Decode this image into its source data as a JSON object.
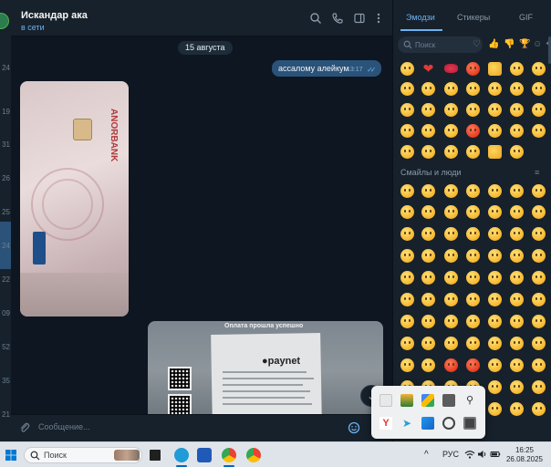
{
  "left_strip": {
    "numbers": [
      "24",
      "19",
      "31",
      "26",
      "25",
      "24",
      "22",
      "09",
      "52",
      "35",
      "21"
    ]
  },
  "chat": {
    "name": "Искандар ака",
    "status": "в сети",
    "date_divider": "15 августа",
    "outgoing_message": {
      "text": "ассалому алейкум",
      "time": "13:17",
      "ticks": "✓✓"
    },
    "card_photo": {
      "brand": "ANORBANK"
    },
    "receipt_photo": {
      "title": "Оплата прошла успешно",
      "logo": "●paynet"
    },
    "scroll_down_glyph": "⌄"
  },
  "input": {
    "placeholder": "Сообщение..."
  },
  "emoji_panel": {
    "tabs": [
      "Эмодзи",
      "Стикеры",
      "GIF"
    ],
    "active_tab": "Эмодзи",
    "search_placeholder": "Поиск",
    "category_icons": [
      "heart-outline",
      "thumbs-up-outline",
      "thumbs-down-outline",
      "trophy-outline",
      "party-outline",
      "sparkles-outline"
    ],
    "category_glyphs": [
      "♡",
      "👍",
      "👎",
      "🏆",
      "☺",
      "✦"
    ],
    "section_title": "Смайлы и люди",
    "section_icon": "≡"
  },
  "taskbar": {
    "search_placeholder": "Поиск",
    "chevron": "^",
    "language": "РУС",
    "time": "16:25",
    "date": "26.08.2025"
  },
  "colors": {
    "accent": "#6ab2f2",
    "bubble_out": "#2b5278",
    "panel_bg": "#17212b",
    "chat_bg": "#0e1621"
  }
}
